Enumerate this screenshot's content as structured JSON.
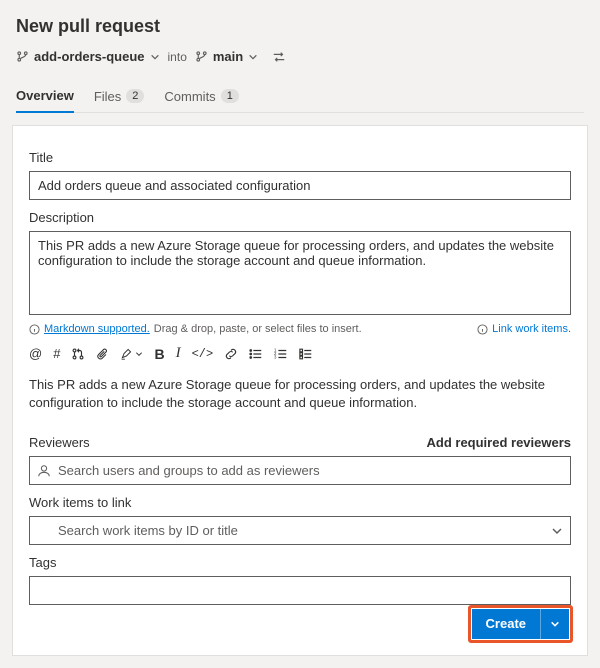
{
  "header": {
    "title": "New pull request",
    "source_branch": "add-orders-queue",
    "into_label": "into",
    "target_branch": "main"
  },
  "tabs": {
    "overview": "Overview",
    "files": {
      "label": "Files",
      "count": "2"
    },
    "commits": {
      "label": "Commits",
      "count": "1"
    }
  },
  "title_field": {
    "label": "Title",
    "value": "Add orders queue and associated configuration"
  },
  "description_field": {
    "label": "Description",
    "value": "This PR adds a new Azure Storage queue for processing orders, and updates the website configuration to include the storage account and queue information."
  },
  "hints": {
    "markdown_link": "Markdown supported.",
    "drag_text": "Drag & drop, paste, or select files to insert.",
    "link_work_items": "Link work items."
  },
  "preview_text": "This PR adds a new Azure Storage queue for processing orders, and updates the website configuration to include the storage account and queue information.",
  "reviewers": {
    "label": "Reviewers",
    "add_required": "Add required reviewers",
    "placeholder": "Search users and groups to add as reviewers"
  },
  "work_items": {
    "label": "Work items to link",
    "placeholder": "Search work items by ID or title"
  },
  "tags": {
    "label": "Tags"
  },
  "create_button": "Create"
}
